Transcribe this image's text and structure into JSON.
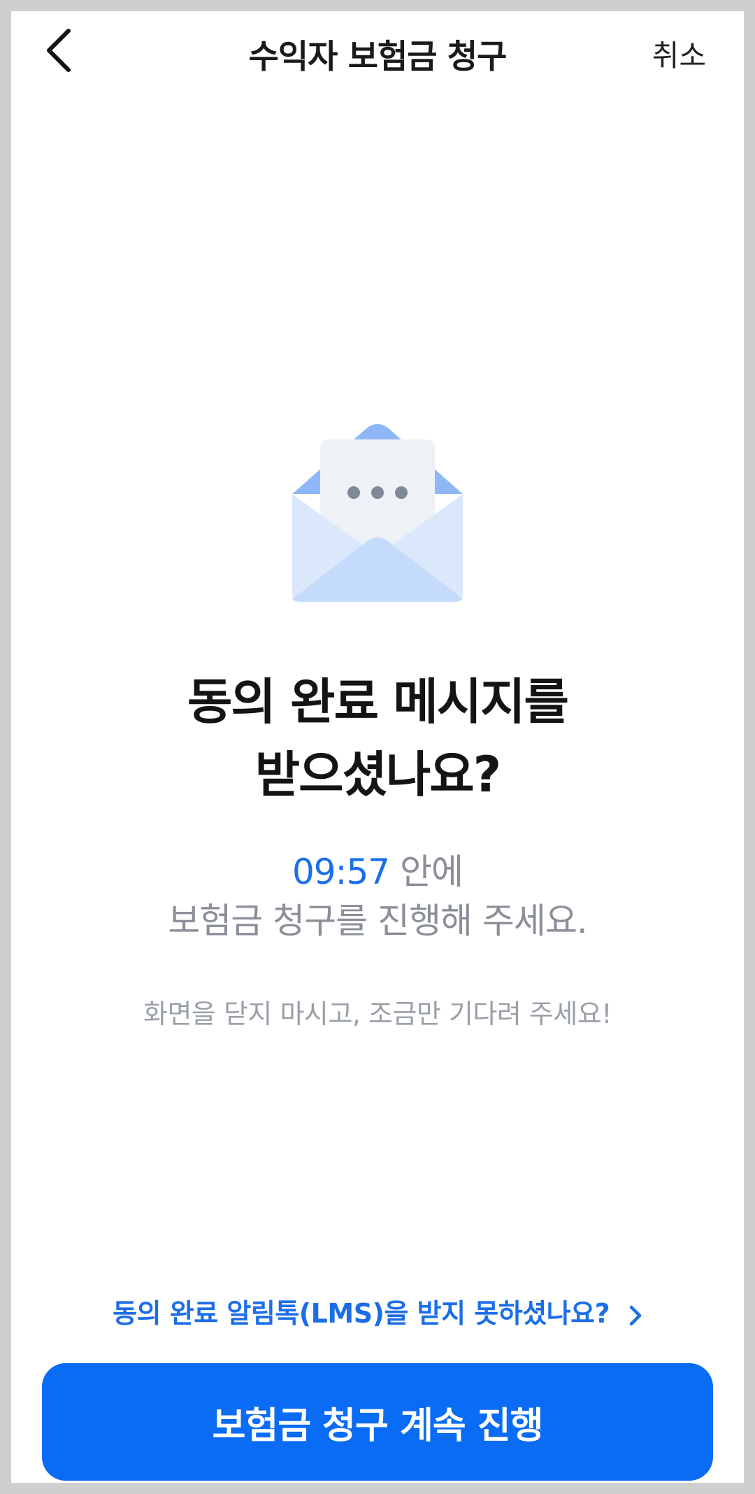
{
  "header": {
    "title": "수익자 보험금 청구",
    "cancel_label": "취소"
  },
  "illustration": {
    "icon": "open-envelope-message-icon"
  },
  "main": {
    "headline_line1": "동의 완료 메시지를",
    "headline_line2": "받으셨나요?",
    "timer_value": "09:57",
    "timer_suffix": " 안에",
    "instruction": "보험금 청구를 진행해 주세요.",
    "note": "화면을 닫지 마시고, 조금만 기다려 주세요!"
  },
  "footer": {
    "lms_link_label": "동의 완료 알림톡(LMS)을 받지 못하셨나요?",
    "continue_button_label": "보험금 청구 계속 진행"
  },
  "colors": {
    "accent": "#0a6cf5",
    "link": "#1c6ee8",
    "envelope_light": "#dbe8fc",
    "envelope_mid": "#c5dbfb",
    "envelope_dark": "#8fb7f7"
  }
}
